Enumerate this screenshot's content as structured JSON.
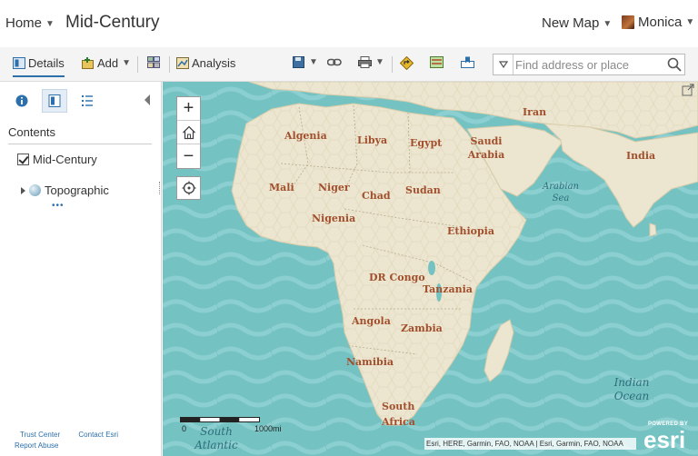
{
  "header": {
    "home_label": "Home",
    "map_title": "Mid-Century",
    "new_map_label": "New Map",
    "user_name": "Monica"
  },
  "toolbar": {
    "details_label": "Details",
    "add_label": "Add",
    "analysis_label": "Analysis"
  },
  "search": {
    "placeholder": "Find address or place"
  },
  "sidebar": {
    "contents_heading": "Contents",
    "layer_label": "Mid-Century",
    "basemap_label": "Topographic",
    "dots": "•••",
    "footer": {
      "trust_center": "Trust Center",
      "contact_esri": "Contact Esri",
      "report_abuse": "Report Abuse"
    }
  },
  "map": {
    "zoom_in": "+",
    "zoom_out": "−",
    "countries": [
      {
        "name": "Iran"
      },
      {
        "name": "Algenia"
      },
      {
        "name": "Libya"
      },
      {
        "name": "Egypt"
      },
      {
        "name": "Saudi Arabia"
      },
      {
        "name": "India"
      },
      {
        "name": "Mali"
      },
      {
        "name": "Niger"
      },
      {
        "name": "Chad"
      },
      {
        "name": "Sudan"
      },
      {
        "name": "Nigenia"
      },
      {
        "name": "Ethiopia"
      },
      {
        "name": "DR Congo"
      },
      {
        "name": "Tanzania"
      },
      {
        "name": "Angola"
      },
      {
        "name": "Zambia"
      },
      {
        "name": "Namibia"
      },
      {
        "name": "South Africa"
      }
    ],
    "seas": {
      "arabian_sea": "Arabian Sea",
      "indian_ocean": "Indian Ocean",
      "south_atlantic": "South Atlantic"
    },
    "scale": {
      "zero": "0",
      "end": "1000mi"
    },
    "attribution": "Esri, HERE, Garmin, FAO, NOAA | Esri, Garmin, FAO, NOAA",
    "logo": {
      "powered_by": "POWERED BY",
      "word": "esri"
    },
    "colors": {
      "water": "#75c2c3",
      "land": "#ece5cf",
      "label": "#a14f2c",
      "accent": "#2c6fab"
    }
  }
}
